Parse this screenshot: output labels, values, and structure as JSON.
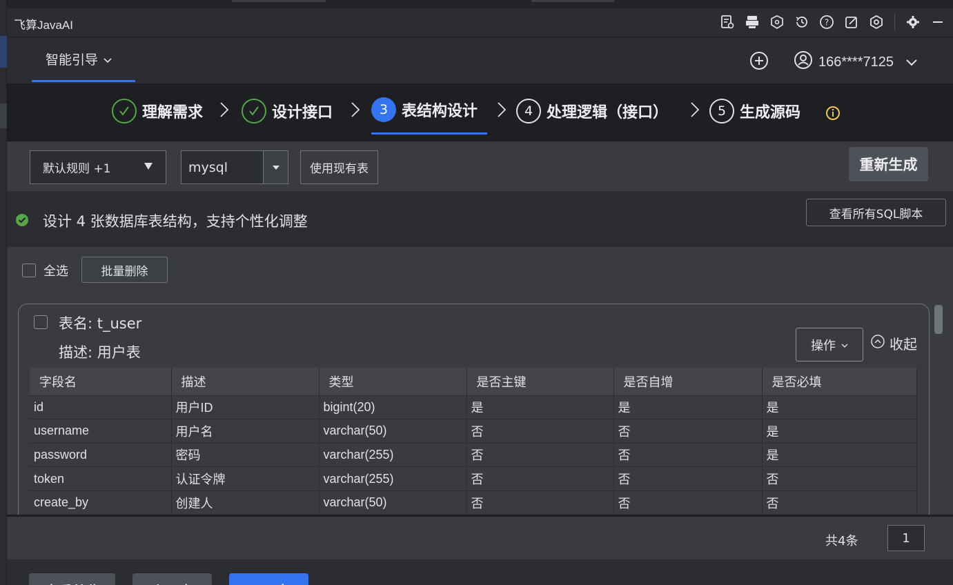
{
  "window": {
    "app_title": "飞算JavaAI"
  },
  "titlebar_icons": [
    "report-icon",
    "mcp-icon",
    "ai-brain-icon",
    "history-icon",
    "help-icon",
    "edit-icon",
    "settings-hex-icon",
    "gear-icon",
    "minimize-icon"
  ],
  "header": {
    "guide_label": "智能引导",
    "user_label": "166****7125"
  },
  "steps": [
    {
      "label": "理解需求",
      "state": "done"
    },
    {
      "label": "设计接口",
      "state": "done"
    },
    {
      "num": "3",
      "label": "表结构设计",
      "state": "active"
    },
    {
      "num": "4",
      "label": "处理逻辑（接口）",
      "state": "todo"
    },
    {
      "num": "5",
      "label": "生成源码",
      "state": "todo"
    }
  ],
  "toolbar": {
    "rule_select": "默认规则 +1",
    "db_select": "mysql",
    "use_existing": "使用现有表",
    "regenerate": "重新生成"
  },
  "status": {
    "message": "设计 4 张数据库表结构，支持个性化调整",
    "view_sql": "查看所有SQL脚本"
  },
  "list": {
    "select_all": "全选",
    "batch_delete": "批量删除"
  },
  "table_card": {
    "name": "表名: t_user",
    "desc": "描述: 用户表",
    "ops": "操作",
    "collapse": "收起",
    "columns": [
      "字段名",
      "描述",
      "类型",
      "是否主键",
      "是否自增",
      "是否必填"
    ],
    "rows": [
      [
        "id",
        "用户ID",
        "bigint(20)",
        "是",
        "是",
        "是"
      ],
      [
        "username",
        "用户名",
        "varchar(50)",
        "否",
        "否",
        "是"
      ],
      [
        "password",
        "密码",
        "varchar(255)",
        "否",
        "否",
        "是"
      ],
      [
        "token",
        "认证令牌",
        "varchar(255)",
        "否",
        "否",
        "否"
      ],
      [
        "create_by",
        "创建人",
        "varchar(50)",
        "否",
        "否",
        "否"
      ]
    ]
  },
  "pager": {
    "total": "共4条",
    "page": "1"
  },
  "bottom_buttons": [
    "查看总览",
    "上一步",
    "下一步"
  ],
  "colors": {
    "accent": "#3574f0",
    "success": "#57a64a",
    "warning": "#f2c55c"
  }
}
